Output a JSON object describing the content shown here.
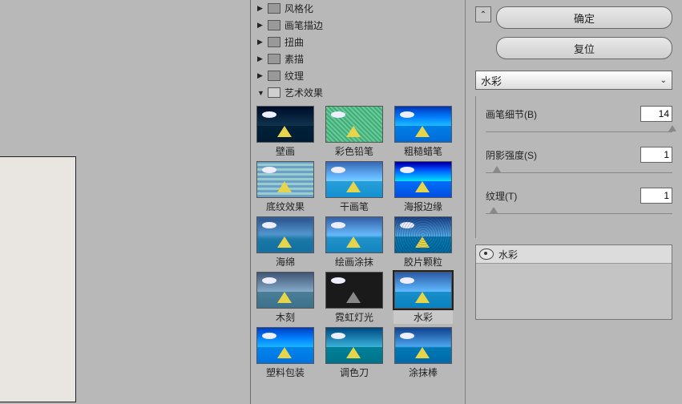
{
  "categories": [
    {
      "label": "风格化",
      "open": false
    },
    {
      "label": "画笔描边",
      "open": false
    },
    {
      "label": "扭曲",
      "open": false
    },
    {
      "label": "素描",
      "open": false
    },
    {
      "label": "纹理",
      "open": false
    },
    {
      "label": "艺术效果",
      "open": true
    }
  ],
  "thumbs": [
    [
      {
        "label": "壁画",
        "cls": "f-dark"
      },
      {
        "label": "彩色铅笔",
        "cls": "f-hatch"
      },
      {
        "label": "粗糙蜡笔",
        "cls": "f-rough"
      }
    ],
    [
      {
        "label": "底纹效果",
        "cls": "f-wave"
      },
      {
        "label": "干画笔",
        "cls": "f-bright"
      },
      {
        "label": "海报边缘",
        "cls": "f-poster"
      }
    ],
    [
      {
        "label": "海绵",
        "cls": "f-blur"
      },
      {
        "label": "绘画涂抹",
        "cls": "f-smudge"
      },
      {
        "label": "胶片颗粒",
        "cls": "f-grain"
      }
    ],
    [
      {
        "label": "木刻",
        "cls": "f-cut"
      },
      {
        "label": "霓虹灯光",
        "cls": "f-neon"
      },
      {
        "label": "水彩",
        "cls": "f-water",
        "selected": true
      }
    ],
    [
      {
        "label": "塑料包装",
        "cls": "f-plastic"
      },
      {
        "label": "调色刀",
        "cls": "f-palette"
      },
      {
        "label": "涂抹棒",
        "cls": "f-daub"
      }
    ]
  ],
  "buttons": {
    "ok": "确定",
    "reset": "复位"
  },
  "dropdown": {
    "selected": "水彩"
  },
  "params": {
    "p1": {
      "label": "画笔细节(B)",
      "value": "14",
      "pos": 98
    },
    "p2": {
      "label": "阴影强度(S)",
      "value": "1",
      "pos": 4
    },
    "p3": {
      "label": "纹理(T)",
      "value": "1",
      "pos": 2
    }
  },
  "layer": {
    "name": "水彩"
  }
}
